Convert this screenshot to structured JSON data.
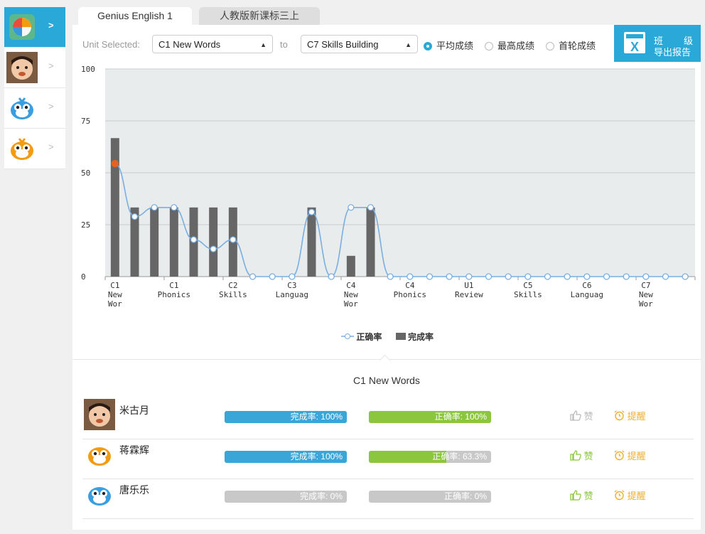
{
  "tabs": [
    {
      "label": "Genius English 1",
      "active": true
    },
    {
      "label": "人教版新课标三上",
      "active": false
    }
  ],
  "sidebar": {
    "items": [
      {
        "name": "app-logo",
        "chevron": ">",
        "active": true
      },
      {
        "name": "student-photo",
        "chevron": ">",
        "active": false
      },
      {
        "name": "blue-mascot",
        "chevron": ">",
        "active": false
      },
      {
        "name": "orange-mascot",
        "chevron": ">",
        "active": false
      }
    ]
  },
  "toolbar": {
    "unit_label": "Unit Selected:",
    "from_unit": "C1 New Words",
    "to_label": "to",
    "to_unit": "C7 Skills Building",
    "radios": [
      {
        "label": "平均成绩",
        "checked": true
      },
      {
        "label": "最高成绩",
        "checked": false
      },
      {
        "label": "首轮成绩",
        "checked": false
      }
    ],
    "export": {
      "line1": "班",
      "line1b": "级",
      "line2": "导出报告",
      "icon": "excel-icon"
    }
  },
  "chart_data": {
    "type": "bar",
    "ylim": [
      0,
      100
    ],
    "yticks": [
      0,
      25,
      50,
      75,
      100
    ],
    "grid": true,
    "x_tick_labels": [
      {
        "index": 0,
        "lines": [
          "C1",
          "New",
          "Wor"
        ]
      },
      {
        "index": 3,
        "lines": [
          "C1",
          "Phonics"
        ]
      },
      {
        "index": 6,
        "lines": [
          "C2",
          "Skills"
        ]
      },
      {
        "index": 9,
        "lines": [
          "C3",
          "Languag"
        ]
      },
      {
        "index": 12,
        "lines": [
          "C4",
          "New",
          "Wor"
        ]
      },
      {
        "index": 15,
        "lines": [
          "C4",
          "Phonics"
        ]
      },
      {
        "index": 18,
        "lines": [
          "U1",
          "Review"
        ]
      },
      {
        "index": 21,
        "lines": [
          "C5",
          "Skills"
        ]
      },
      {
        "index": 24,
        "lines": [
          "C6",
          "Languag"
        ]
      },
      {
        "index": 27,
        "lines": [
          "C7",
          "New",
          "Wor"
        ]
      }
    ],
    "categories_count": 30,
    "series": [
      {
        "name": "完成率",
        "kind": "bar",
        "color": "#666666",
        "values": [
          66.7,
          33.3,
          33.3,
          33.3,
          33.3,
          33.3,
          33.3,
          0,
          0,
          0,
          33.3,
          0,
          10,
          33.3,
          0,
          0,
          0,
          0,
          0,
          0,
          0,
          0,
          0,
          0,
          0,
          0,
          0,
          0,
          0,
          0
        ]
      },
      {
        "name": "正确率",
        "kind": "line",
        "color": "#7aaee0",
        "values": [
          54.4,
          28.9,
          33.3,
          33.3,
          17.8,
          13.3,
          17.8,
          0,
          0,
          0,
          31.1,
          0,
          33.3,
          33.3,
          0,
          0,
          0,
          0,
          0,
          0,
          0,
          0,
          0,
          0,
          0,
          0,
          0,
          0,
          0,
          0
        ],
        "highlight_index": 0,
        "highlight_color": "#e8621c"
      }
    ],
    "legend": [
      {
        "label": "正确率",
        "marker": "line-circle"
      },
      {
        "label": "完成率",
        "marker": "square"
      }
    ]
  },
  "detail": {
    "title": "C1 New Words",
    "students": [
      {
        "name": "米古月",
        "avatar": "student-photo",
        "completion_label": "完成率: 100%",
        "completion": 1.0,
        "accuracy_label": "正确率: 100%",
        "accuracy": 1.0,
        "like": "赞",
        "like_active": false,
        "remind": "提醒"
      },
      {
        "name": "蒋霖辉",
        "avatar": "orange-mascot",
        "completion_label": "完成率: 100%",
        "completion": 1.0,
        "accuracy_label": "正确率: 63.3%",
        "accuracy": 0.633,
        "like": "赞",
        "like_active": true,
        "remind": "提醒"
      },
      {
        "name": "唐乐乐",
        "avatar": "blue-mascot",
        "completion_label": "完成率:   0%",
        "completion": 0,
        "accuracy_label": "正确率:   0%",
        "accuracy": 0,
        "like": "赞",
        "like_active": true,
        "remind": "提醒"
      }
    ]
  },
  "colors": {
    "accent": "#2aa9d8",
    "completion": "#3aa6d8",
    "accuracy": "#8cc63f",
    "empty": "#c8c8c8",
    "like_on": "#8cc63f",
    "like_off": "#bbbbbb"
  }
}
